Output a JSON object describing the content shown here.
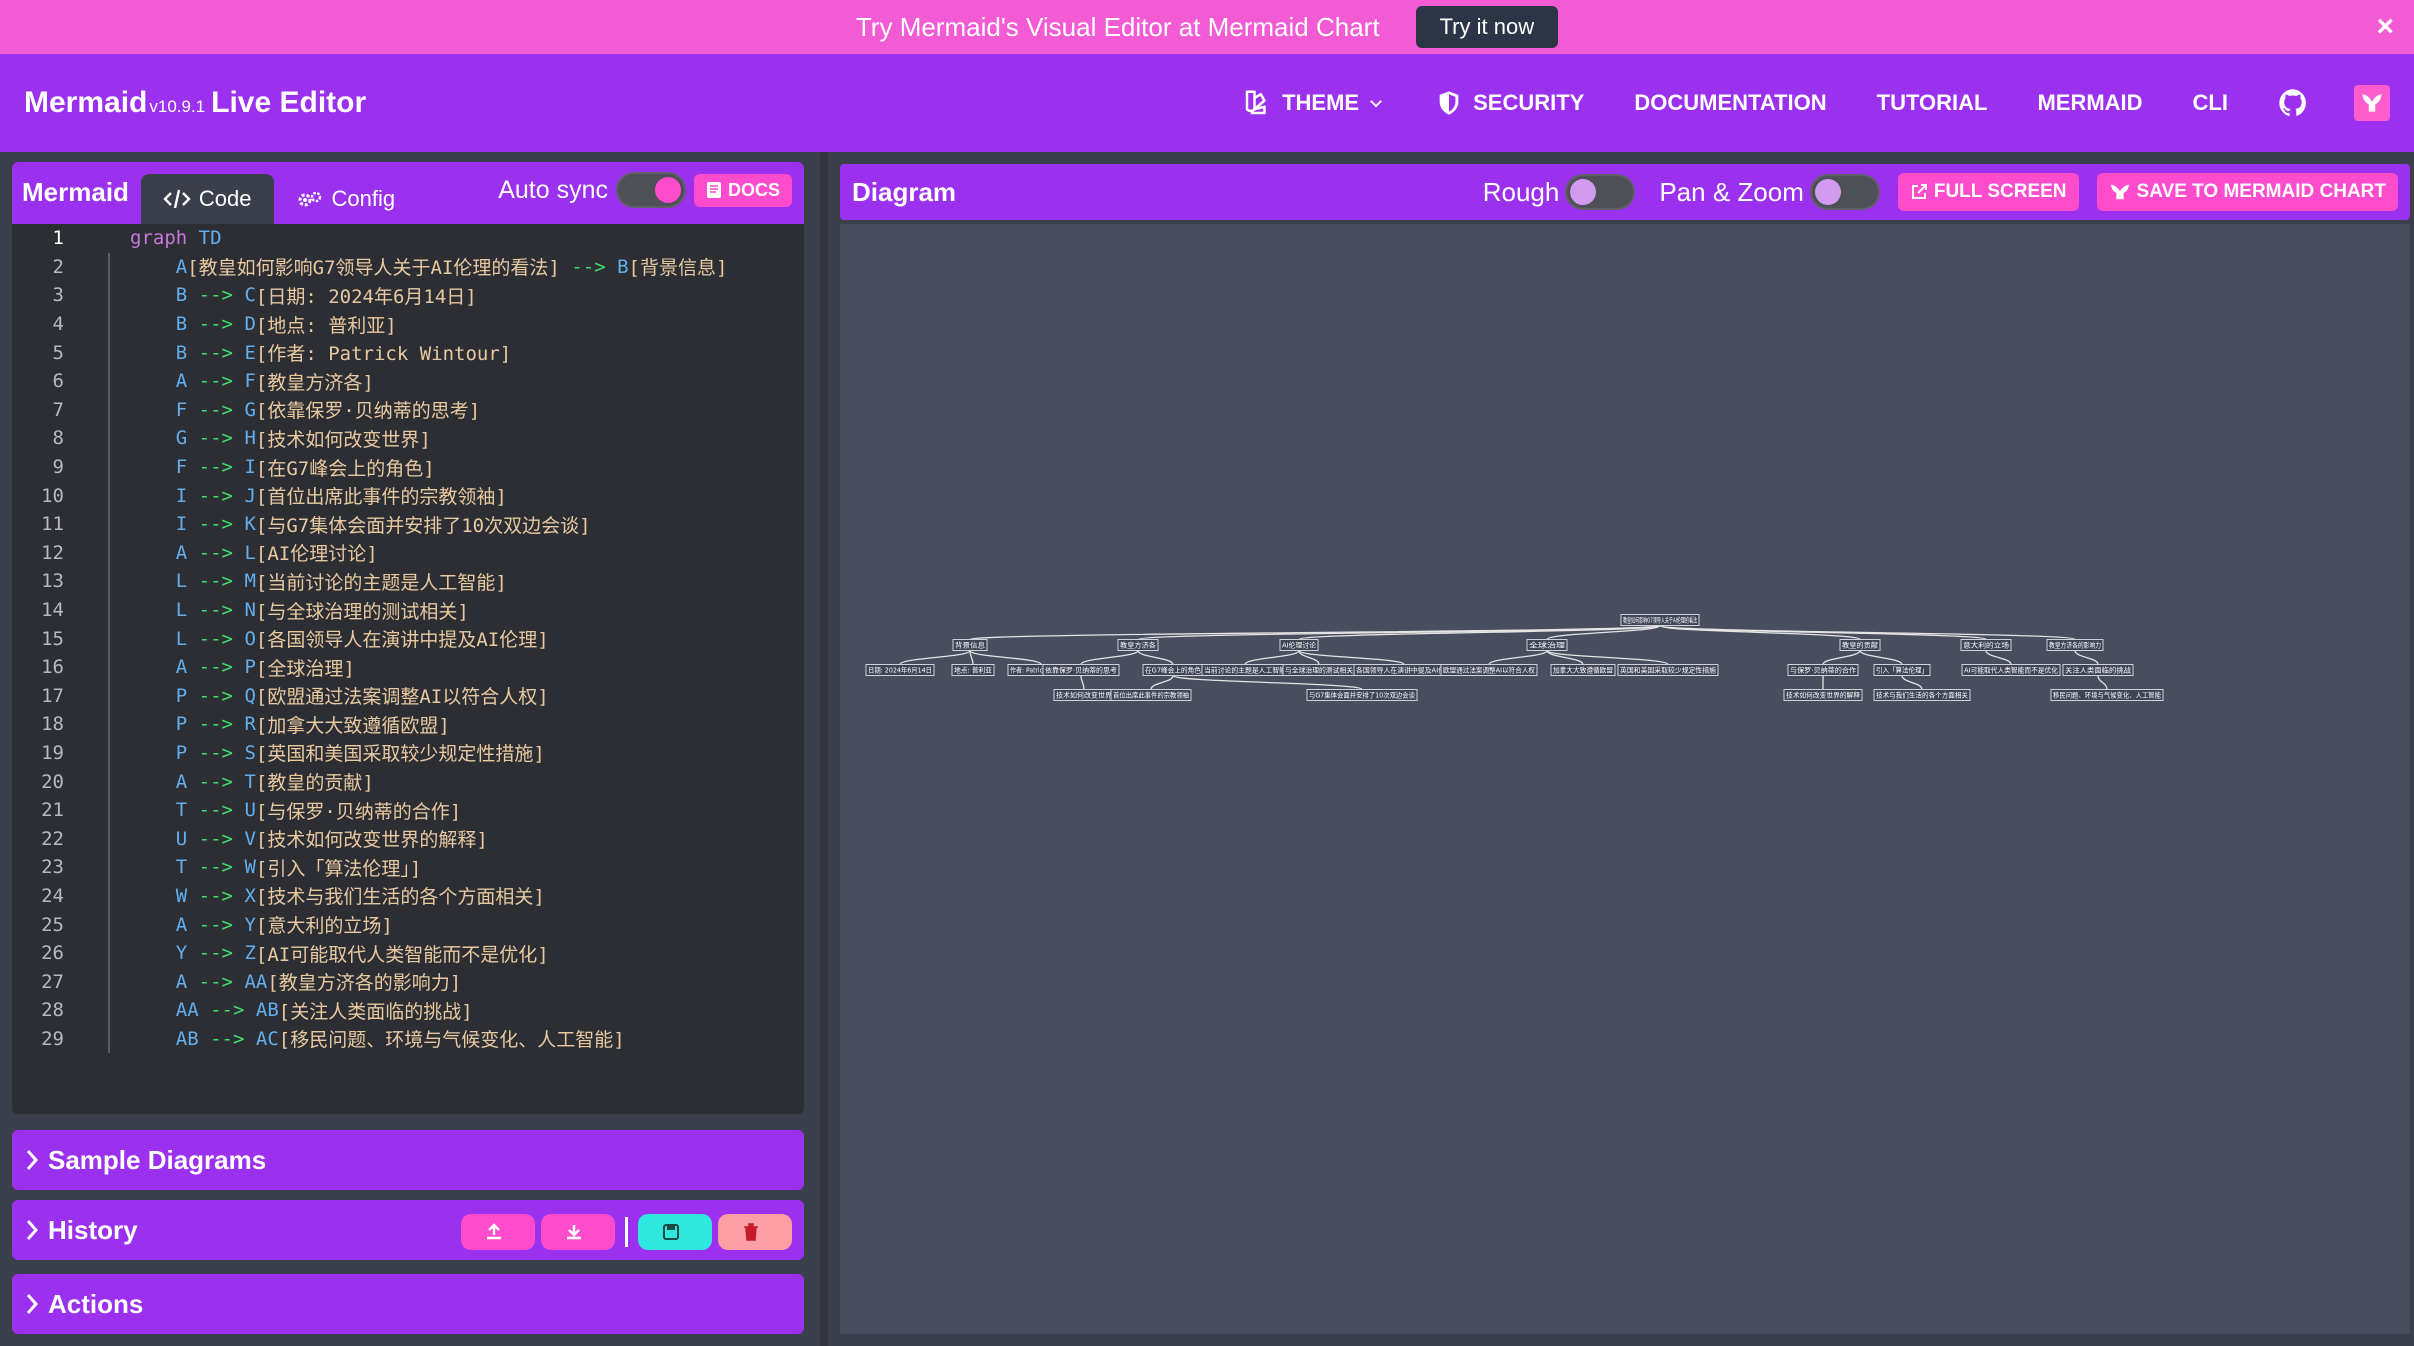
{
  "banner": {
    "text": "Try Mermaid's Visual Editor at Mermaid Chart",
    "button": "Try it now",
    "close": "×"
  },
  "nav": {
    "brand": "Mermaid",
    "version": "v10.9.1",
    "live_editor": "Live Editor",
    "theme": "THEME",
    "security": "SECURITY",
    "documentation": "DOCUMENTATION",
    "tutorial": "TUTORIAL",
    "mermaid": "MERMAID",
    "cli": "CLI"
  },
  "editor": {
    "title": "Mermaid",
    "tab_code": "Code",
    "tab_config": "Config",
    "auto_sync": "Auto sync",
    "auto_sync_on": true,
    "docs": "DOCS"
  },
  "code_lines": [
    [
      [
        "kw",
        "graph"
      ],
      [
        "plain",
        " "
      ],
      [
        "id",
        "TD"
      ]
    ],
    [
      [
        "plain",
        "    "
      ],
      [
        "id",
        "A"
      ],
      [
        "txt",
        "[教皇如何影响G7领导人关于AI伦理的看法]"
      ],
      [
        "plain",
        " "
      ],
      [
        "arrow",
        "-->"
      ],
      [
        "plain",
        " "
      ],
      [
        "id",
        "B"
      ],
      [
        "txt",
        "[背景信息]"
      ]
    ],
    [
      [
        "plain",
        "    "
      ],
      [
        "id",
        "B"
      ],
      [
        "plain",
        " "
      ],
      [
        "arrow",
        "-->"
      ],
      [
        "plain",
        " "
      ],
      [
        "id",
        "C"
      ],
      [
        "txt",
        "[日期: 2024年6月14日]"
      ]
    ],
    [
      [
        "plain",
        "    "
      ],
      [
        "id",
        "B"
      ],
      [
        "plain",
        " "
      ],
      [
        "arrow",
        "-->"
      ],
      [
        "plain",
        " "
      ],
      [
        "id",
        "D"
      ],
      [
        "txt",
        "[地点: 普利亚]"
      ]
    ],
    [
      [
        "plain",
        "    "
      ],
      [
        "id",
        "B"
      ],
      [
        "plain",
        " "
      ],
      [
        "arrow",
        "-->"
      ],
      [
        "plain",
        " "
      ],
      [
        "id",
        "E"
      ],
      [
        "txt",
        "[作者: Patrick Wintour]"
      ]
    ],
    [
      [
        "plain",
        "    "
      ],
      [
        "id",
        "A"
      ],
      [
        "plain",
        " "
      ],
      [
        "arrow",
        "-->"
      ],
      [
        "plain",
        " "
      ],
      [
        "id",
        "F"
      ],
      [
        "txt",
        "[教皇方济各]"
      ]
    ],
    [
      [
        "plain",
        "    "
      ],
      [
        "id",
        "F"
      ],
      [
        "plain",
        " "
      ],
      [
        "arrow",
        "-->"
      ],
      [
        "plain",
        " "
      ],
      [
        "id",
        "G"
      ],
      [
        "txt",
        "[依靠保罗·贝纳蒂的思考]"
      ]
    ],
    [
      [
        "plain",
        "    "
      ],
      [
        "id",
        "G"
      ],
      [
        "plain",
        " "
      ],
      [
        "arrow",
        "-->"
      ],
      [
        "plain",
        " "
      ],
      [
        "id",
        "H"
      ],
      [
        "txt",
        "[技术如何改变世界]"
      ]
    ],
    [
      [
        "plain",
        "    "
      ],
      [
        "id",
        "F"
      ],
      [
        "plain",
        " "
      ],
      [
        "arrow",
        "-->"
      ],
      [
        "plain",
        " "
      ],
      [
        "id",
        "I"
      ],
      [
        "txt",
        "[在G7峰会上的角色]"
      ]
    ],
    [
      [
        "plain",
        "    "
      ],
      [
        "id",
        "I"
      ],
      [
        "plain",
        " "
      ],
      [
        "arrow",
        "-->"
      ],
      [
        "plain",
        " "
      ],
      [
        "id",
        "J"
      ],
      [
        "txt",
        "[首位出席此事件的宗教领袖]"
      ]
    ],
    [
      [
        "plain",
        "    "
      ],
      [
        "id",
        "I"
      ],
      [
        "plain",
        " "
      ],
      [
        "arrow",
        "-->"
      ],
      [
        "plain",
        " "
      ],
      [
        "id",
        "K"
      ],
      [
        "txt",
        "[与G7集体会面并安排了10次双边会谈]"
      ]
    ],
    [
      [
        "plain",
        "    "
      ],
      [
        "id",
        "A"
      ],
      [
        "plain",
        " "
      ],
      [
        "arrow",
        "-->"
      ],
      [
        "plain",
        " "
      ],
      [
        "id",
        "L"
      ],
      [
        "txt",
        "[AI伦理讨论]"
      ]
    ],
    [
      [
        "plain",
        "    "
      ],
      [
        "id",
        "L"
      ],
      [
        "plain",
        " "
      ],
      [
        "arrow",
        "-->"
      ],
      [
        "plain",
        " "
      ],
      [
        "id",
        "M"
      ],
      [
        "txt",
        "[当前讨论的主题是人工智能]"
      ]
    ],
    [
      [
        "plain",
        "    "
      ],
      [
        "id",
        "L"
      ],
      [
        "plain",
        " "
      ],
      [
        "arrow",
        "-->"
      ],
      [
        "plain",
        " "
      ],
      [
        "id",
        "N"
      ],
      [
        "txt",
        "[与全球治理的测试相关]"
      ]
    ],
    [
      [
        "plain",
        "    "
      ],
      [
        "id",
        "L"
      ],
      [
        "plain",
        " "
      ],
      [
        "arrow",
        "-->"
      ],
      [
        "plain",
        " "
      ],
      [
        "id",
        "O"
      ],
      [
        "txt",
        "[各国领导人在演讲中提及AI伦理]"
      ]
    ],
    [
      [
        "plain",
        "    "
      ],
      [
        "id",
        "A"
      ],
      [
        "plain",
        " "
      ],
      [
        "arrow",
        "-->"
      ],
      [
        "plain",
        " "
      ],
      [
        "id",
        "P"
      ],
      [
        "txt",
        "[全球治理]"
      ]
    ],
    [
      [
        "plain",
        "    "
      ],
      [
        "id",
        "P"
      ],
      [
        "plain",
        " "
      ],
      [
        "arrow",
        "-->"
      ],
      [
        "plain",
        " "
      ],
      [
        "id",
        "Q"
      ],
      [
        "txt",
        "[欧盟通过法案调整AI以符合人权]"
      ]
    ],
    [
      [
        "plain",
        "    "
      ],
      [
        "id",
        "P"
      ],
      [
        "plain",
        " "
      ],
      [
        "arrow",
        "-->"
      ],
      [
        "plain",
        " "
      ],
      [
        "id",
        "R"
      ],
      [
        "txt",
        "[加拿大大致遵循欧盟]"
      ]
    ],
    [
      [
        "plain",
        "    "
      ],
      [
        "id",
        "P"
      ],
      [
        "plain",
        " "
      ],
      [
        "arrow",
        "-->"
      ],
      [
        "plain",
        " "
      ],
      [
        "id",
        "S"
      ],
      [
        "txt",
        "[英国和美国采取较少规定性措施]"
      ]
    ],
    [
      [
        "plain",
        "    "
      ],
      [
        "id",
        "A"
      ],
      [
        "plain",
        " "
      ],
      [
        "arrow",
        "-->"
      ],
      [
        "plain",
        " "
      ],
      [
        "id",
        "T"
      ],
      [
        "txt",
        "[教皇的贡献]"
      ]
    ],
    [
      [
        "plain",
        "    "
      ],
      [
        "id",
        "T"
      ],
      [
        "plain",
        " "
      ],
      [
        "arrow",
        "-->"
      ],
      [
        "plain",
        " "
      ],
      [
        "id",
        "U"
      ],
      [
        "txt",
        "[与保罗·贝纳蒂的合作]"
      ]
    ],
    [
      [
        "plain",
        "    "
      ],
      [
        "id",
        "U"
      ],
      [
        "plain",
        " "
      ],
      [
        "arrow",
        "-->"
      ],
      [
        "plain",
        " "
      ],
      [
        "id",
        "V"
      ],
      [
        "txt",
        "[技术如何改变世界的解释]"
      ]
    ],
    [
      [
        "plain",
        "    "
      ],
      [
        "id",
        "T"
      ],
      [
        "plain",
        " "
      ],
      [
        "arrow",
        "-->"
      ],
      [
        "plain",
        " "
      ],
      [
        "id",
        "W"
      ],
      [
        "txt",
        "[引入「算法伦理」]"
      ]
    ],
    [
      [
        "plain",
        "    "
      ],
      [
        "id",
        "W"
      ],
      [
        "plain",
        " "
      ],
      [
        "arrow",
        "-->"
      ],
      [
        "plain",
        " "
      ],
      [
        "id",
        "X"
      ],
      [
        "txt",
        "[技术与我们生活的各个方面相关]"
      ]
    ],
    [
      [
        "plain",
        "    "
      ],
      [
        "id",
        "A"
      ],
      [
        "plain",
        " "
      ],
      [
        "arrow",
        "-->"
      ],
      [
        "plain",
        " "
      ],
      [
        "id",
        "Y"
      ],
      [
        "txt",
        "[意大利的立场]"
      ]
    ],
    [
      [
        "plain",
        "    "
      ],
      [
        "id",
        "Y"
      ],
      [
        "plain",
        " "
      ],
      [
        "arrow",
        "-->"
      ],
      [
        "plain",
        " "
      ],
      [
        "id",
        "Z"
      ],
      [
        "txt",
        "[AI可能取代人类智能而不是优化]"
      ]
    ],
    [
      [
        "plain",
        "    "
      ],
      [
        "id",
        "A"
      ],
      [
        "plain",
        " "
      ],
      [
        "arrow",
        "-->"
      ],
      [
        "plain",
        " "
      ],
      [
        "id",
        "AA"
      ],
      [
        "txt",
        "[教皇方济各的影响力]"
      ]
    ],
    [
      [
        "plain",
        "    "
      ],
      [
        "id",
        "AA"
      ],
      [
        "plain",
        " "
      ],
      [
        "arrow",
        "-->"
      ],
      [
        "plain",
        " "
      ],
      [
        "id",
        "AB"
      ],
      [
        "txt",
        "[关注人类面临的挑战]"
      ]
    ],
    [
      [
        "plain",
        "    "
      ],
      [
        "id",
        "AB"
      ],
      [
        "plain",
        " "
      ],
      [
        "arrow",
        "-->"
      ],
      [
        "plain",
        " "
      ],
      [
        "id",
        "AC"
      ],
      [
        "txt",
        "[移民问题、环境与气候变化、人工智能]"
      ]
    ]
  ],
  "accordions": {
    "sample": "Sample Diagrams",
    "history": "History",
    "actions": "Actions"
  },
  "diagram": {
    "title": "Diagram",
    "rough": "Rough",
    "rough_on": false,
    "pan_zoom": "Pan & Zoom",
    "pan_zoom_on": false,
    "full_screen": "FULL SCREEN",
    "save": "SAVE TO MERMAID CHART"
  },
  "mermaid_nodes": {
    "A": "教皇如何影响G7领导人关于AI伦理的看法",
    "B": "背景信息",
    "C": "日期: 2024年6月14日",
    "D": "地点: 普利亚",
    "E": "作者: Patrick Wintour",
    "F": "教皇方济各",
    "G": "依靠保罗·贝纳蒂的思考",
    "H": "技术如何改变世界",
    "I": "在G7峰会上的角色",
    "J": "首位出席此事件的宗教领袖",
    "K": "与G7集体会面并安排了10次双边会谈",
    "L": "AI伦理讨论",
    "M": "当前讨论的主题是人工智能",
    "N": "与全球治理的测试相关",
    "O": "各国领导人在演讲中提及AI伦理",
    "P": "全球治理",
    "Q": "欧盟通过法案调整AI以符合人权",
    "R": "加拿大大致遵循欧盟",
    "S": "英国和美国采取较少规定性措施",
    "T": "教皇的贡献",
    "U": "与保罗·贝纳蒂的合作",
    "V": "技术如何改变世界的解释",
    "W": "引入「算法伦理」",
    "X": "技术与我们生活的各个方面相关",
    "Y": "意大利的立场",
    "Z": "AI可能取代人类智能而不是优化",
    "AA": "教皇方济各的影响力",
    "AB": "关注人类面临的挑战",
    "AC": "移民问题、环境与气候变化、人工智能"
  },
  "colors": {
    "banner": "#f35bd4",
    "nav": "#9b31ee",
    "accent": "#ff4ccd",
    "editor_bg": "#2d2e33",
    "canvas_bg": "#494e5e"
  }
}
